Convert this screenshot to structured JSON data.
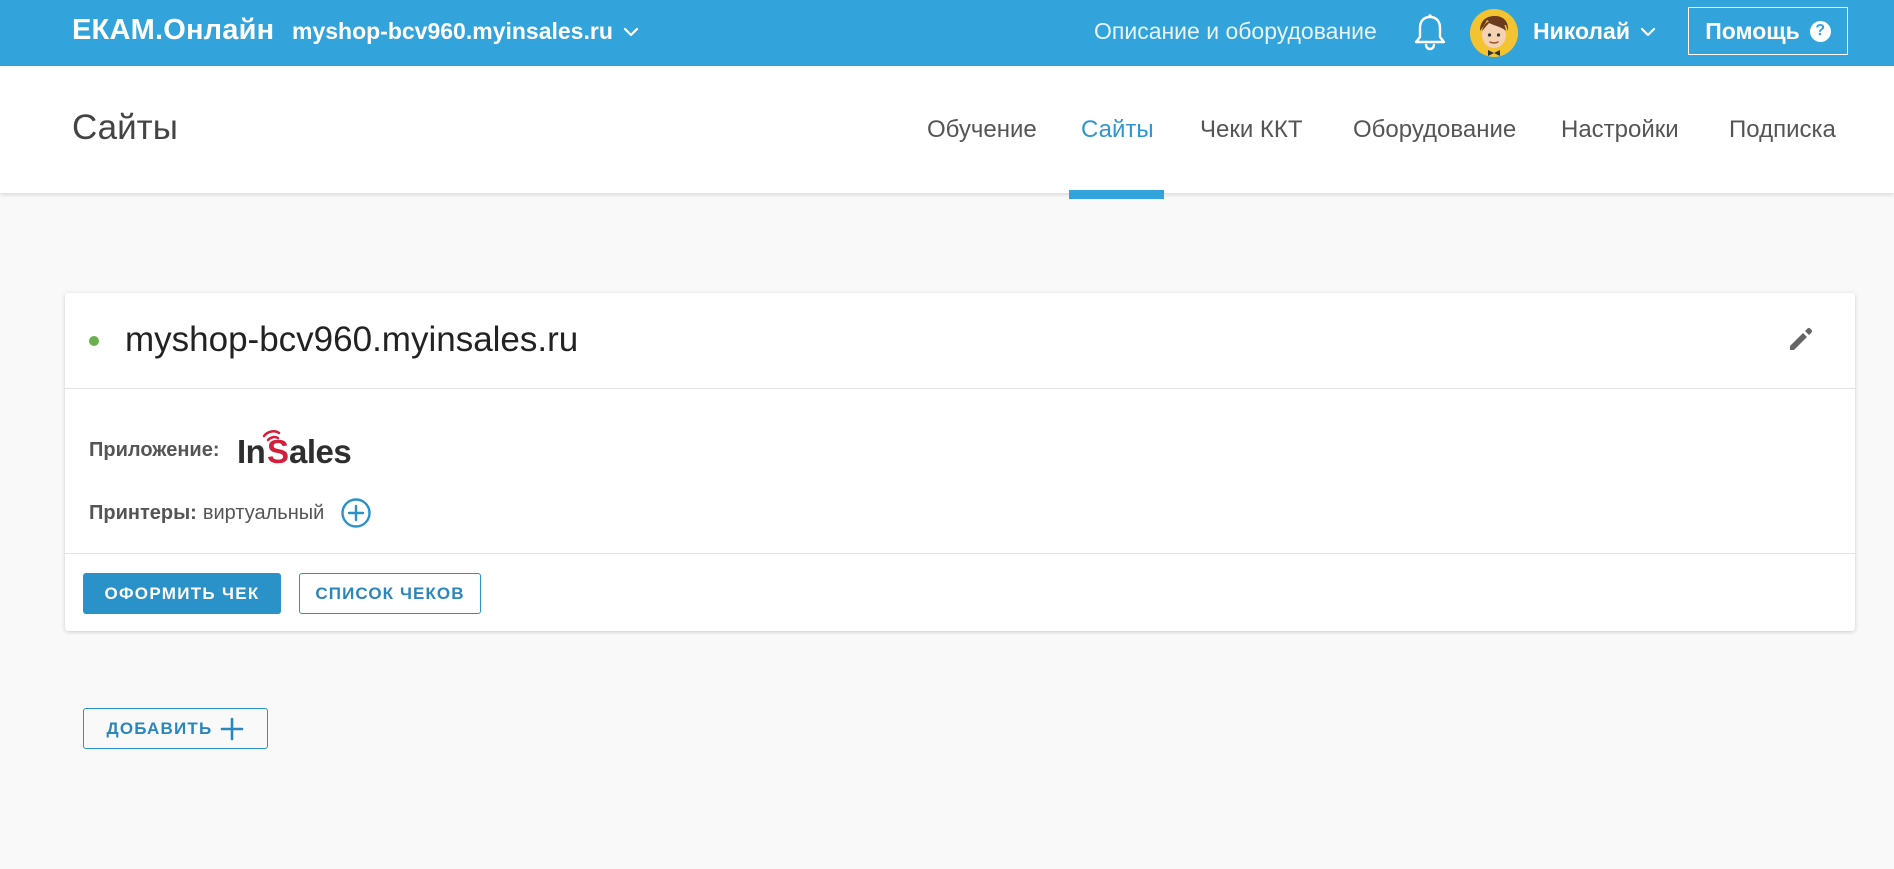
{
  "topbar": {
    "brand": "ЕКАМ.Онлайн",
    "site_selector": "myshop-bcv960.myinsales.ru",
    "description_link": "Описание и оборудование",
    "user_name": "Николай",
    "help_label": "Помощь",
    "help_glyph": "?",
    "background_color": "#33a3db"
  },
  "subheader": {
    "page_title": "Сайты",
    "tabs": [
      {
        "label": "Обучение",
        "active": false
      },
      {
        "label": "Сайты",
        "active": true
      },
      {
        "label": "Чеки ККТ",
        "active": false
      },
      {
        "label": "Оборудование",
        "active": false
      },
      {
        "label": "Настройки",
        "active": false
      },
      {
        "label": "Подписка",
        "active": false
      }
    ],
    "accent_color": "#33a3db"
  },
  "site_card": {
    "title": "myshop-bcv960.myinsales.ru",
    "status": "active",
    "status_color": "#6ab04c",
    "app_label": "Приложение:",
    "app_logo_text": "InSales",
    "printers_label": "Принтеры:",
    "printers_value": "виртуальный",
    "primary_button": "ОФОРМИТЬ ЧЕК",
    "secondary_button": "СПИСОК ЧЕКОВ"
  },
  "add_button": "ДОБАВИТЬ",
  "icons": {
    "site_dropdown": "chevron-down-icon",
    "notifications": "bell-icon",
    "user_menu": "chevron-down-icon",
    "help": "question-circle-icon",
    "edit": "pencil-icon",
    "add_printer": "plus-circle-icon",
    "add": "plus-icon"
  }
}
